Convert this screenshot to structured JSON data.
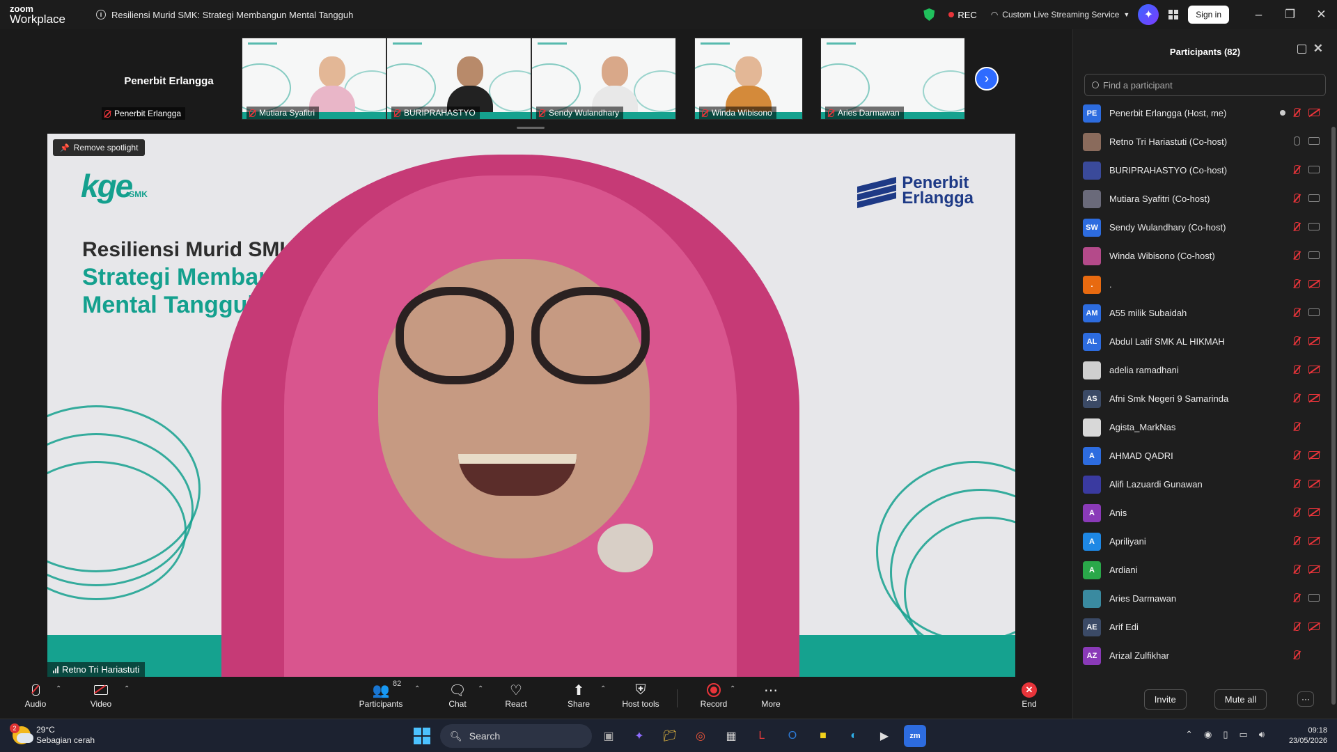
{
  "app": {
    "logo_top": "zoom",
    "logo_bottom": "Workplace"
  },
  "meeting": {
    "title": "Resiliensi Murid SMK: Strategi Membangun Mental Tangguh",
    "rec_label": "REC",
    "stream_label": "Custom Live Streaming Service",
    "signin_label": "Sign in"
  },
  "filmstrip": {
    "self_name": "Penerbit Erlangga",
    "self_tag": "Penerbit Erlangga",
    "tiles": [
      {
        "name": "Mutiara Syafitri"
      },
      {
        "name": "BURIPRAHASTYO"
      },
      {
        "name": "Sendy Wulandhary"
      },
      {
        "name": "Winda Wibisono"
      },
      {
        "name": "Aries Darmawan"
      }
    ]
  },
  "stage": {
    "spotlight_label": "Remove spotlight",
    "logo_text": "kge",
    "logo_sub": "SMK",
    "slide_title_line1": "Resiliensi Murid SMK:",
    "slide_title_line2": "Strategi Membangun",
    "slide_title_line3": "Mental Tangguh",
    "brand_line1": "Penerbit",
    "brand_line2": "Erlangga",
    "speaker": "Retno Tri Hariastuti"
  },
  "participants": {
    "title": "Participants (82)",
    "search_placeholder": "Find a participant",
    "invite_label": "Invite",
    "mute_all_label": "Mute all",
    "more_label": "···",
    "list": [
      {
        "initials": "PE",
        "name": "Penerbit Erlangga (Host, me)",
        "color": "#2d6cdf",
        "mic": "off",
        "cam": "off",
        "host": true
      },
      {
        "initials": "",
        "name": "Retno Tri Hariastuti (Co-host)",
        "color": "#8a6b5c",
        "mic": "on",
        "cam": "on"
      },
      {
        "initials": "",
        "name": "BURIPRAHASTYO (Co-host)",
        "color": "#3a4a9a",
        "mic": "off",
        "cam": "on"
      },
      {
        "initials": "",
        "name": "Mutiara Syafitri (Co-host)",
        "color": "#6a6a7a",
        "mic": "off",
        "cam": "on"
      },
      {
        "initials": "SW",
        "name": "Sendy Wulandhary (Co-host)",
        "color": "#2d6cdf",
        "mic": "off",
        "cam": "on"
      },
      {
        "initials": "",
        "name": "Winda Wibisono (Co-host)",
        "color": "#b44a8a",
        "mic": "off",
        "cam": "on"
      },
      {
        "initials": ".",
        "name": ".",
        "color": "#e86a10",
        "mic": "off",
        "cam": "off"
      },
      {
        "initials": "AM",
        "name": "A55 milik Subaidah",
        "color": "#2d6cdf",
        "mic": "off",
        "cam": "on"
      },
      {
        "initials": "AL",
        "name": "Abdul Latif SMK AL HIKMAH",
        "color": "#2d6cdf",
        "mic": "off",
        "cam": "off"
      },
      {
        "initials": "",
        "name": "adelia ramadhani",
        "color": "#cfcfcf",
        "mic": "off",
        "cam": "off"
      },
      {
        "initials": "AS",
        "name": "Afni  Smk Negeri 9 Samarinda",
        "color": "#3b4a66",
        "mic": "off",
        "cam": "off"
      },
      {
        "initials": "",
        "name": "Agista_MarkNas",
        "color": "#d8d8d8",
        "mic": "off",
        "cam": "none"
      },
      {
        "initials": "A",
        "name": "AHMAD QADRI",
        "color": "#2d6cdf",
        "mic": "off",
        "cam": "off"
      },
      {
        "initials": "",
        "name": "Alifi Lazuardi Gunawan",
        "color": "#3a3aa0",
        "mic": "off",
        "cam": "off"
      },
      {
        "initials": "A",
        "name": "Anis",
        "color": "#8a3ab8",
        "mic": "off",
        "cam": "off"
      },
      {
        "initials": "A",
        "name": "Apriliyani",
        "color": "#1e88e5",
        "mic": "off",
        "cam": "off"
      },
      {
        "initials": "A",
        "name": "Ardiani",
        "color": "#2aa84a",
        "mic": "off",
        "cam": "off"
      },
      {
        "initials": "",
        "name": "Aries Darmawan",
        "color": "#3a8aa0",
        "mic": "off",
        "cam": "on"
      },
      {
        "initials": "AE",
        "name": "Arif Edi",
        "color": "#3b4a66",
        "mic": "off",
        "cam": "off"
      },
      {
        "initials": "AZ",
        "name": "Arizal Zulfikhar",
        "color": "#8a3ab8",
        "mic": "off",
        "cam": "none"
      }
    ]
  },
  "toolbar": {
    "audio": "Audio",
    "video": "Video",
    "participants": "Participants",
    "participants_count": "82",
    "chat": "Chat",
    "react": "React",
    "share": "Share",
    "host_tools": "Host tools",
    "record": "Record",
    "more": "More",
    "end": "End"
  },
  "taskbar": {
    "temp": "29°C",
    "weather": "Sebagian cerah",
    "weather_badge": "2",
    "search": "Search",
    "time": "09:18",
    "date": "23/05/2026"
  }
}
